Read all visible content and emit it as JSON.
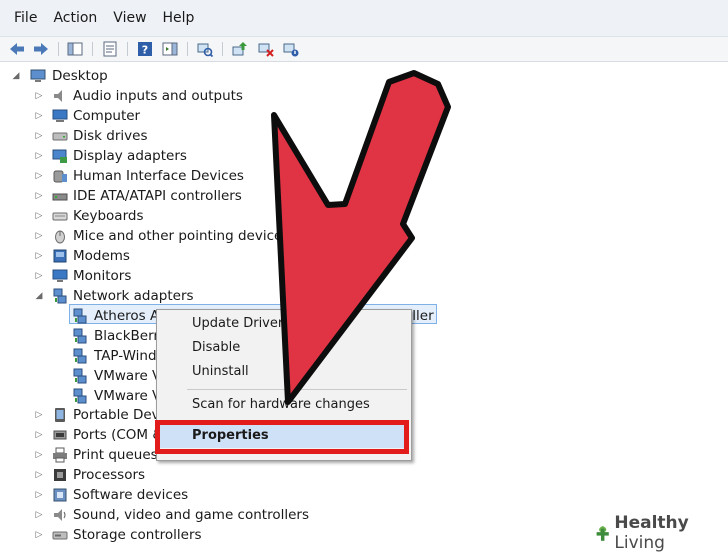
{
  "menubar": {
    "items": [
      "File",
      "Action",
      "View",
      "Help"
    ]
  },
  "toolbar": {
    "icons": [
      "back-arrow-icon",
      "forward-arrow-icon",
      "show-hide-console-tree-icon",
      "properties-icon",
      "help-icon",
      "action-pane-icon",
      "scan-hardware-icon",
      "update-driver-icon",
      "uninstall-device-icon",
      "disable-device-icon"
    ]
  },
  "tree": {
    "root": "Desktop",
    "categories": [
      "Audio inputs and outputs",
      "Computer",
      "Disk drives",
      "Display adapters",
      "Human Interface Devices",
      "IDE ATA/ATAPI controllers",
      "Keyboards",
      "Mice and other pointing devices",
      "Modems",
      "Monitors",
      "Network adapters"
    ],
    "network_children": [
      "Atheros A",
      "BlackBerry",
      "TAP-Wind",
      "VMware V",
      "VMware V"
    ],
    "selected_suffix": "oller",
    "after": [
      "Portable Devi",
      "Ports (COM &",
      "Print queues",
      "Processors",
      "Software devices",
      "Sound, video and game controllers",
      "Storage controllers"
    ]
  },
  "context_menu": {
    "items": [
      "Update Driver",
      "Disable",
      "Uninstall",
      "Scan for hardware changes",
      "Properties"
    ],
    "highlighted": "Properties"
  },
  "watermark": {
    "brand_a": "Healthy",
    "brand_b": "Living"
  },
  "colors": {
    "annotation_arrow": "#e03344",
    "annotation_box": "#e21b1b",
    "selection": "#cfe1f6"
  }
}
